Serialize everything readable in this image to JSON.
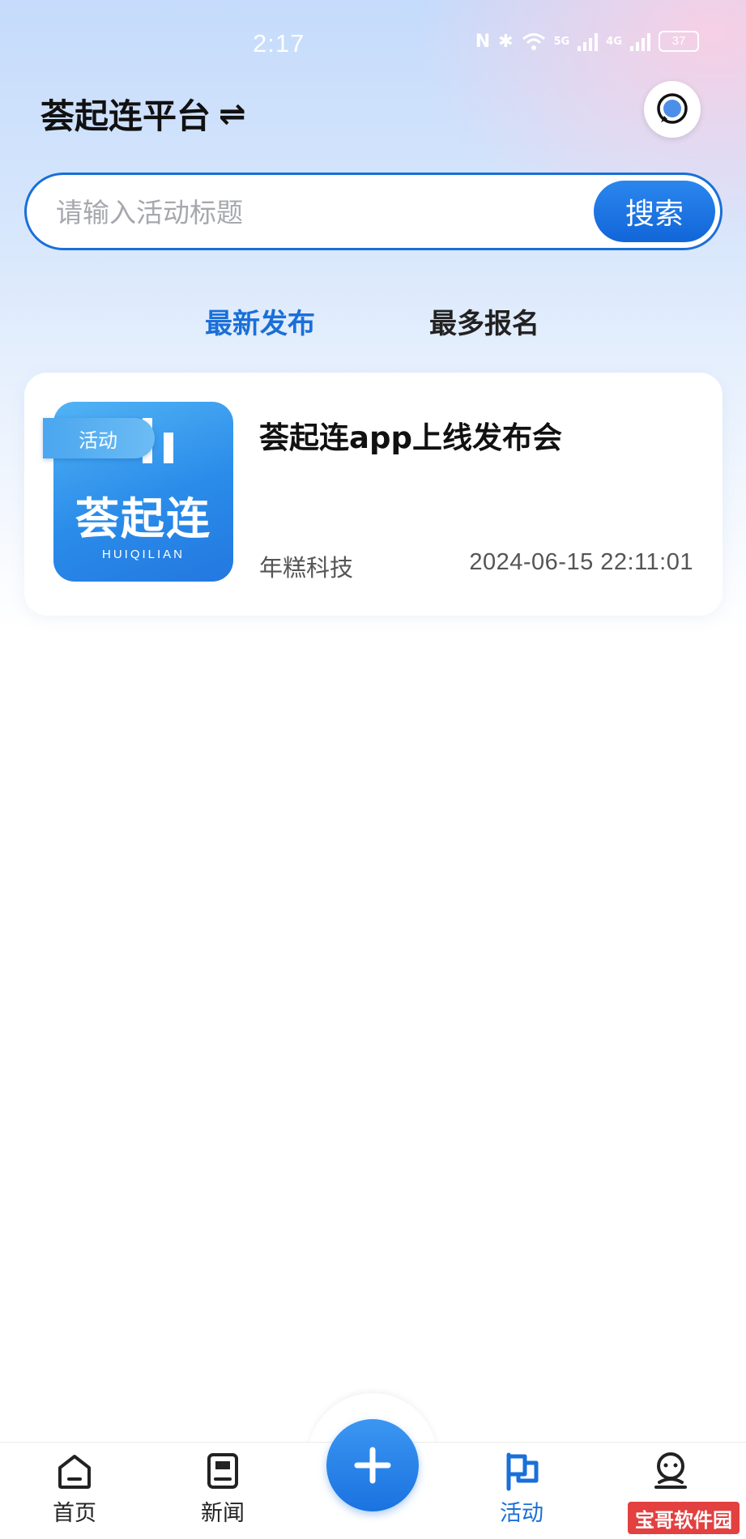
{
  "status_bar": {
    "time": "2:17",
    "network_a": "5G",
    "network_b": "4G",
    "battery": "37"
  },
  "header": {
    "title": "荟起连平台"
  },
  "search": {
    "placeholder": "请输入活动标题",
    "button_label": "搜索"
  },
  "tabs": [
    {
      "label": "最新发布",
      "active": true
    },
    {
      "label": "最多报名",
      "active": false
    }
  ],
  "activities": [
    {
      "tag": "活动",
      "thumbnail_logo": "荟起连",
      "thumbnail_sub": "HUIQILIAN",
      "title": "荟起连app上线发布会",
      "organizer": "年糕科技",
      "time": "2024-06-15 22:11:01"
    }
  ],
  "bottom_nav": [
    {
      "label": "首页",
      "icon": "home-icon",
      "active": false
    },
    {
      "label": "新闻",
      "icon": "news-icon",
      "active": false
    },
    {
      "label": "活动",
      "icon": "flag-icon",
      "active": true
    },
    {
      "label": "我的",
      "icon": "profile-icon",
      "active": false
    }
  ],
  "watermark": "宝哥软件园",
  "colors": {
    "accent": "#1a6fd8",
    "text": "#111111",
    "muted": "#555555"
  }
}
